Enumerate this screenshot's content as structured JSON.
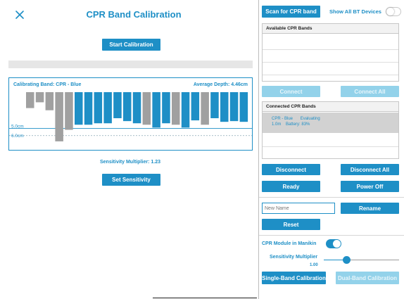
{
  "left": {
    "title": "CPR Band Calibration",
    "close_icon": "close-icon",
    "start_button": "Start Calibration",
    "panel": {
      "band_label": "Calibrating Band: CPR - Blue",
      "depth_label": "Average Depth:",
      "depth_value": "4.46cm",
      "ref_5": "5.0cm",
      "ref_6": "6.0cm"
    },
    "sensitivity_label": "Sensitivity Multiplier:",
    "sensitivity_value": "1.23",
    "set_button": "Set Sensitivity"
  },
  "chart_data": {
    "type": "bar",
    "title": "",
    "xlabel": "",
    "ylabel": "",
    "ylim": [
      0,
      7
    ],
    "reference_lines": [
      5.0,
      6.0
    ],
    "values": [
      2.2,
      1.4,
      2.5,
      6.8,
      5.2,
      4.5,
      4.5,
      4.3,
      4.3,
      3.6,
      4.0,
      4.3,
      4.5,
      4.9,
      4.3,
      4.5,
      4.9,
      3.9,
      4.5,
      3.6,
      4.1,
      4.0,
      4.1
    ],
    "colors": [
      "#a0a0a0",
      "#a0a0a0",
      "#a0a0a0",
      "#a0a0a0",
      "#a0a0a0",
      "#1e8fc6",
      "#1e8fc6",
      "#1e8fc6",
      "#1e8fc6",
      "#1e8fc6",
      "#1e8fc6",
      "#1e8fc6",
      "#a0a0a0",
      "#1e8fc6",
      "#1e8fc6",
      "#a0a0a0",
      "#1e8fc6",
      "#1e8fc6",
      "#a0a0a0",
      "#1e8fc6",
      "#1e8fc6",
      "#1e8fc6",
      "#1e8fc6"
    ],
    "colors_legend": {
      "in_range": "#1e8fc6",
      "out_of_range": "#a0a0a0"
    }
  },
  "right": {
    "scan_button": "Scan for CPR band",
    "show_all_label": "Show All BT Devices",
    "available_header": "Available CPR Bands",
    "connect_button": "Connect",
    "connect_all_button": "Connect All",
    "connected_header": "Connected CPR Bands",
    "connected_item": {
      "name": "CPR - Blue",
      "status": "Evaluating",
      "version": "1.0m",
      "battery_label": "Battery:",
      "battery_value": "83%"
    },
    "disconnect_button": "Disconnect",
    "disconnect_all_button": "Disconnect All",
    "ready_button": "Ready",
    "power_off_button": "Power Off",
    "name_placeholder": "New Name",
    "rename_button": "Rename",
    "reset_button": "Reset",
    "manikin_label": "CPR Module in Manikin",
    "manikin_toggle": true,
    "sensitivity_label": "Sensitivity Multiplier",
    "sensitivity_value": "1.00",
    "slider_fraction": 0.3,
    "single_button": "Single-Band Calibration",
    "dual_button": "Dual-Band Calibration"
  }
}
